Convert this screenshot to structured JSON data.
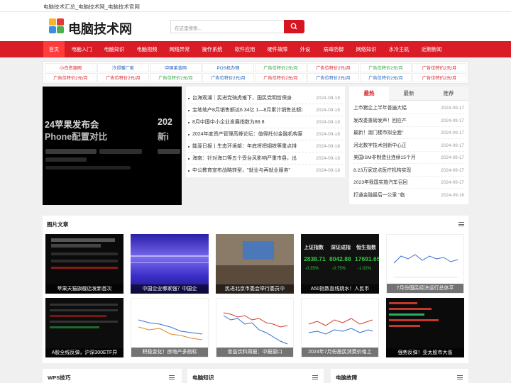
{
  "topbar": {
    "text": "电脑技术汇总_电脑技术网_电脑技术官网"
  },
  "header": {
    "logo_text": "电脑技术网",
    "search_placeholder": "在这里搜索..."
  },
  "nav": [
    "首页",
    "电脑入门",
    "电脑知识",
    "电脑视频",
    "网络异常",
    "操作系统",
    "软件应用",
    "硬件故障",
    "外设",
    "病毒防御",
    "网络知识",
    "水冷主机",
    "近期新闻"
  ],
  "links": {
    "row1": [
      "小白资源网",
      "冷却暖厂家",
      "中国莱普网",
      "POS机办理",
      "广告位特价2元/月",
      "广告位特价2元/月",
      "广告位特价2元/月",
      "广告位特价2元/月"
    ],
    "row2": [
      "广告位特价2元/月",
      "广告位特价2元/月",
      "广告位特价2元/月",
      "广告位特价2元/月",
      "广告位特价2元/月",
      "广告位特价2元/月",
      "广告位特价2元/月",
      "广告位特价2元/月"
    ]
  },
  "slider": {
    "line1": "24苹果发布会",
    "line2": "Phone配置对比",
    "line3": "202",
    "line4": "新i"
  },
  "news": [
    {
      "title": "台海观澜｜民进党骑虎难下，国民党明哲保身",
      "date": "2024-09-18"
    },
    {
      "title": "宝地地产8月销售额达6.34亿 1—8月累计销售总额突",
      "date": "2024-09-18"
    },
    {
      "title": "8月中国中小企业发展指数为88.8",
      "date": "2024-09-18"
    },
    {
      "title": "2024年度资产管理高峰论坛：值得托付金融机构案",
      "date": "2024-09-18"
    },
    {
      "title": "能源日报丨生态环境部：年底将把钢铁等重点排",
      "date": "2024-09-18"
    },
    {
      "title": "海南：针对海口等五个受台风影响严重市县，出",
      "date": "2024-09-18"
    },
    {
      "title": "中公教育宣布战略转型，\"就业与再就业服务\"",
      "date": "2024-09-18"
    }
  ],
  "hot": {
    "tabs": [
      "最热",
      "最新",
      "推荐"
    ],
    "items": [
      {
        "title": "上市猪企上半年普遍大幅",
        "date": "2024-09-17"
      },
      {
        "title": "发改委重磅发声！回应产",
        "date": "2024-09-17"
      },
      {
        "title": "最新！澳门楼市拟全面\"",
        "date": "2024-09-17"
      },
      {
        "title": "河北数字技术创新中心正",
        "date": "2024-09-17"
      },
      {
        "title": "美国ISM非制造业连续15个月",
        "date": "2024-09-17"
      },
      {
        "title": "8.23万家定点医疗机构实现",
        "date": "2024-09-17"
      },
      {
        "title": "2023年我国实施汽车召回",
        "date": "2024-09-17"
      },
      {
        "title": "打通金融最后一公里 \"临",
        "date": "2024-09-16"
      }
    ]
  },
  "pics": {
    "title": "图片文章",
    "items": [
      {
        "caption": "苹果天猫旗舰店发新首次"
      },
      {
        "caption": "中国企业哪家强？中国企"
      },
      {
        "caption": "民进北京市委会举行委员中"
      },
      {
        "caption": "A50指数直线跳水！人民币"
      },
      {
        "caption": "7月份国民经济运行总体平"
      },
      {
        "caption": "A股全线反弹，沪深300ETF异"
      },
      {
        "caption": "积极变化！房地产多指标"
      },
      {
        "caption": "食品饮料周报：中报窗口"
      },
      {
        "caption": "2024年7月份居民消费价格上"
      },
      {
        "caption": "强势反弹！亚太股市大涨"
      }
    ]
  },
  "bottom": [
    "WPS技巧",
    "电脑知识",
    "电脑故障"
  ],
  "thumb3": {
    "a": "上证指数",
    "av": "2838.71",
    "ac": "-0.35%",
    "b": "深证成指",
    "bv": "8042.88",
    "bc": "-0.75%",
    "c": "恒生指数",
    "cv": "17691.65",
    "cc": "-1.02%"
  },
  "colors": {
    "brand": "#d91c26",
    "nav_active": "#ff3b3b",
    "link_red": "#d91c26",
    "link_blue": "#1f5fbf",
    "link_green": "#2aa33a"
  }
}
